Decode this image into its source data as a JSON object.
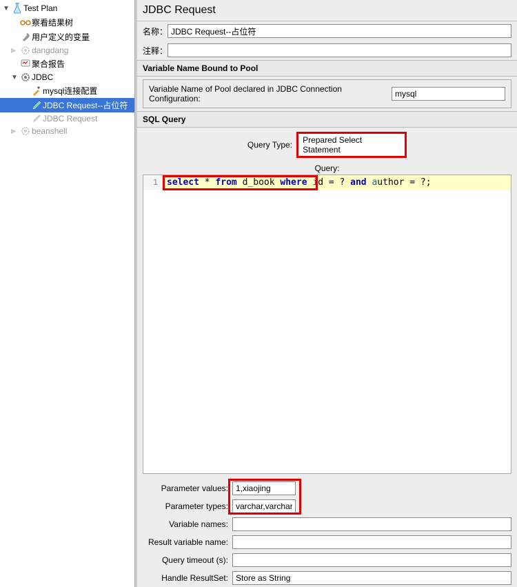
{
  "tree": {
    "root": "Test Plan",
    "items": [
      "察看结果树",
      "用户定义的变量",
      "dangdang",
      "聚合报告",
      "JDBC"
    ],
    "jdbc_children": [
      "mysql连接配置",
      "JDBC Request--占位符",
      "JDBC Request"
    ],
    "last": "beanshell"
  },
  "header": {
    "title": "JDBC Request"
  },
  "form": {
    "name_label": "名称：",
    "name_value": "JDBC Request--占位符",
    "comment_label": "注释：",
    "comment_value": ""
  },
  "pool_section": {
    "header": "Variable Name Bound to Pool",
    "label": "Variable Name of Pool declared in JDBC Connection Configuration:",
    "value": "mysql"
  },
  "sql_section": {
    "header": "SQL Query",
    "query_type_label": "Query Type:",
    "query_type_value": "Prepared Select Statement",
    "query_label": "Query:",
    "line_num": "1",
    "sql": {
      "select": "select",
      "star": " * ",
      "from": "from",
      "table": " d_book ",
      "where": "where",
      "col1_pre": " ",
      "col1": "i",
      "col1b": "d",
      "eq1": " = ? ",
      "and": "and",
      "col2_pre": " ",
      "col2a": "a",
      "col2b": "uthor",
      "eq2": " = ?;"
    }
  },
  "params": {
    "values_label": "Parameter values:",
    "values": "1,xiaojing",
    "types_label": "Parameter types:",
    "types": "varchar,varchar",
    "varnames_label": "Variable names:",
    "varnames": "",
    "resultvar_label": "Result variable name:",
    "resultvar": "",
    "timeout_label": "Query timeout (s):",
    "timeout": "",
    "resultset_label": "Handle ResultSet:",
    "resultset": "Store as String"
  }
}
